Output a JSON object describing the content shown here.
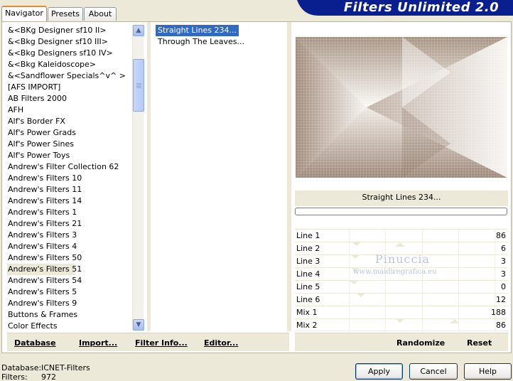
{
  "tabs": [
    "Navigator",
    "Presets",
    "About"
  ],
  "app_title": "Filters Unlimited 2.0",
  "categories": [
    "&<BKg Designer sf10 II>",
    "&<Bkg Designer sf10 III>",
    "&<Bkg Designers sf10 IV>",
    "&<Bkg Kaleidoscope>",
    "&<Sandflower Specials^v^ >",
    "[AFS IMPORT]",
    "AB Filters 2000",
    "AFH",
    "Alf's Border FX",
    "Alf's Power Grads",
    "Alf's Power Sines",
    "Alf's Power Toys",
    "Andrew's Filter Collection 62",
    "Andrew's Filters 10",
    "Andrew's Filters 11",
    "Andrew's Filters 14",
    "Andrew's Filters 1",
    "Andrew's Filters 21",
    "Andrew's Filters 3",
    "Andrew's Filters 4",
    "Andrew's Filters 50",
    "Andrew's Filters 51",
    "Andrew's Filters 54",
    "Andrew's Filters 5",
    "Andrew's Filters 9",
    "Buttons & Frames",
    "Color Effects"
  ],
  "selected_category": "Andrew's Filters 51",
  "filters": [
    "Straight Lines 234...",
    "Through The Leaves..."
  ],
  "selected_filter": "Straight Lines 234...",
  "preview_filter_name": "Straight Lines 234...",
  "params": [
    {
      "label": "Line 1",
      "value": "86",
      "fraction": 0.34
    },
    {
      "label": "Line 2",
      "value": "6",
      "fraction": 0.02
    },
    {
      "label": "Line 3",
      "value": "3",
      "fraction": 0.01
    },
    {
      "label": "Line 4",
      "value": "3",
      "fraction": 0.01
    },
    {
      "label": "Line 5",
      "value": "0",
      "fraction": 0.0
    },
    {
      "label": "Line 6",
      "value": "12",
      "fraction": 0.05
    },
    {
      "label": "Mix 1",
      "value": "188",
      "fraction": 0.74
    },
    {
      "label": "Mix 2",
      "value": "86",
      "fraction": 0.34
    }
  ],
  "watermark": {
    "name": "Pinuccia",
    "site": "www.maidiregrafica.eu"
  },
  "actions": {
    "database": "Database",
    "import": "Import...",
    "filter_info": "Filter Info...",
    "editor": "Editor...",
    "randomize": "Randomize",
    "reset": "Reset"
  },
  "footer": {
    "database_label": "Database:",
    "database_value": "ICNET-Filters",
    "filters_label": "Filters:",
    "filters_value": "972"
  },
  "buttons": {
    "apply": "Apply",
    "cancel": "Cancel",
    "help": "Help"
  },
  "colors": {
    "banner": "#0a1f8f",
    "selection": "#316ac5",
    "face": "#ece9d8",
    "preview_light": "#f4f1ee",
    "preview_dark": "#a28f80"
  }
}
